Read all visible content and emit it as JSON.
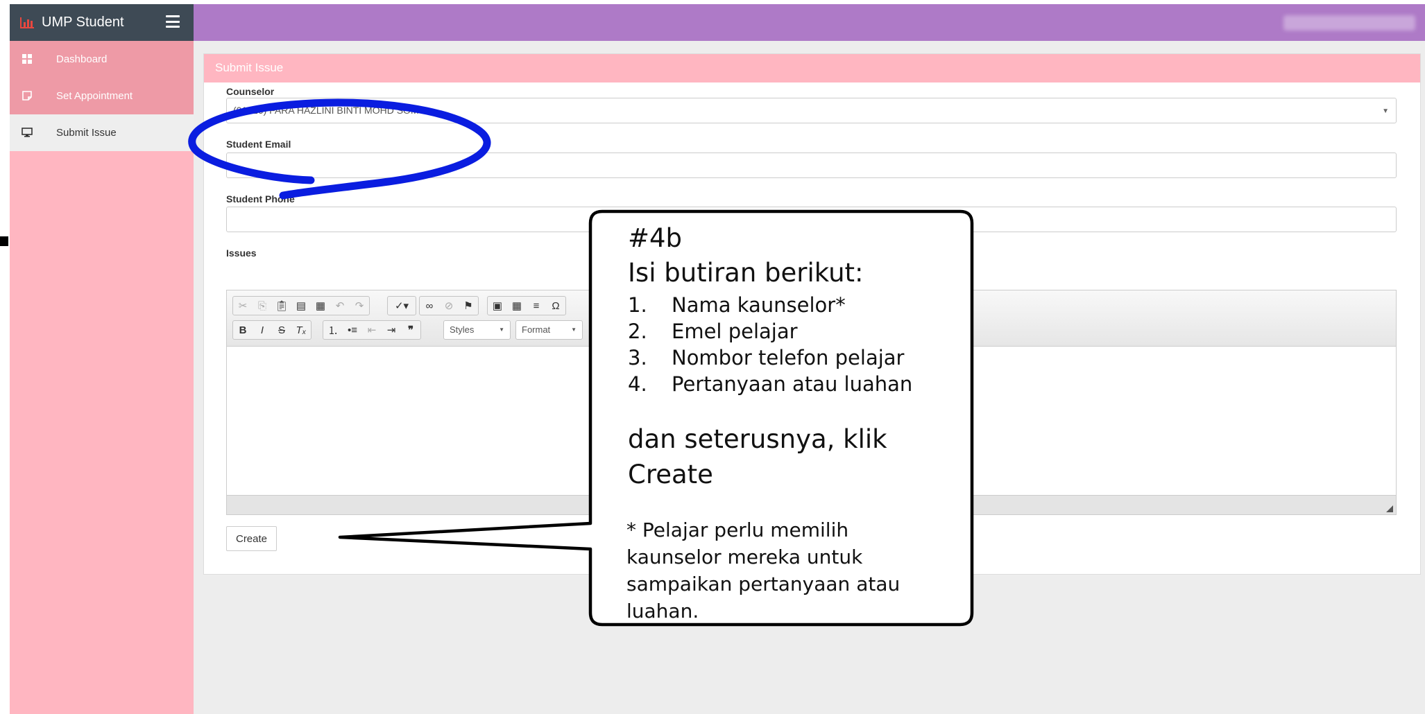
{
  "app": {
    "title": "UMP Student",
    "user_name": "",
    "brand_color": "#3e4a55",
    "topbar_color": "#ae7ac7",
    "accent_color": "#ffb6c1"
  },
  "sidebar": {
    "items": [
      {
        "label": "Dashboard",
        "icon": "grid-icon",
        "active": false
      },
      {
        "label": "Set Appointment",
        "icon": "note-icon",
        "active": false
      },
      {
        "label": "Submit Issue",
        "icon": "monitor-icon",
        "active": true
      }
    ]
  },
  "form": {
    "panel_title": "Submit Issue",
    "counselor": {
      "label": "Counselor",
      "value": "(01426) FARA HAZLINI BINTI MOHD SOM"
    },
    "student_email": {
      "label": "Student Email",
      "value": ""
    },
    "student_phone": {
      "label": "Student Phone",
      "value": ""
    },
    "issues": {
      "label": "Issues",
      "styles_label": "Styles",
      "format_label": "Format",
      "value": ""
    },
    "submit_label": "Create"
  },
  "annotation": {
    "tag": "#4b",
    "heading": "Isi butiran berikut:",
    "items": [
      {
        "num": "1.",
        "text": "Nama kaunselor*"
      },
      {
        "num": "2.",
        "text": "Emel pelajar"
      },
      {
        "num": "3.",
        "text": "Nombor telefon pelajar"
      },
      {
        "num": "4.",
        "text": "Pertanyaan atau luahan"
      }
    ],
    "instruction_line1": "dan seterusnya, klik",
    "instruction_line2": "Create",
    "note": "* Pelajar perlu memilih kaunselor mereka untuk sampaikan pertanyaan atau luahan.",
    "highlight_color": "#0a1de0"
  }
}
